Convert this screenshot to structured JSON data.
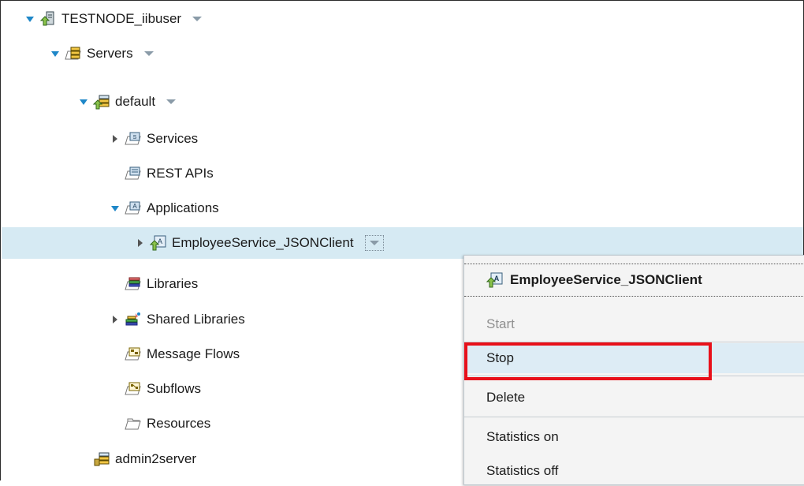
{
  "tree": {
    "node": {
      "label": "TESTNODE_iibuser"
    },
    "servers": {
      "label": "Servers"
    },
    "server_default": {
      "label": "default"
    },
    "services": {
      "label": "Services"
    },
    "rest_apis": {
      "label": "REST APIs"
    },
    "applications": {
      "label": "Applications"
    },
    "app_item": {
      "label": "EmployeeService_JSONClient"
    },
    "libraries": {
      "label": "Libraries"
    },
    "shared_libraries": {
      "label": "Shared Libraries"
    },
    "message_flows": {
      "label": "Message Flows"
    },
    "subflows": {
      "label": "Subflows"
    },
    "resources": {
      "label": "Resources"
    },
    "admin2server": {
      "label": "admin2server"
    }
  },
  "context_menu": {
    "header": "EmployeeService_JSONClient",
    "items": [
      {
        "label": "Start",
        "state": "disabled"
      },
      {
        "label": "Stop",
        "state": "highlighted"
      },
      {
        "label": "Delete",
        "state": "enabled"
      },
      {
        "label": "Statistics on",
        "state": "enabled"
      },
      {
        "label": "Statistics off",
        "state": "enabled"
      }
    ]
  },
  "colors": {
    "selection": "#d6eaf3",
    "twisty_open": "#1e87c8",
    "highlight_box": "#e8101a"
  }
}
